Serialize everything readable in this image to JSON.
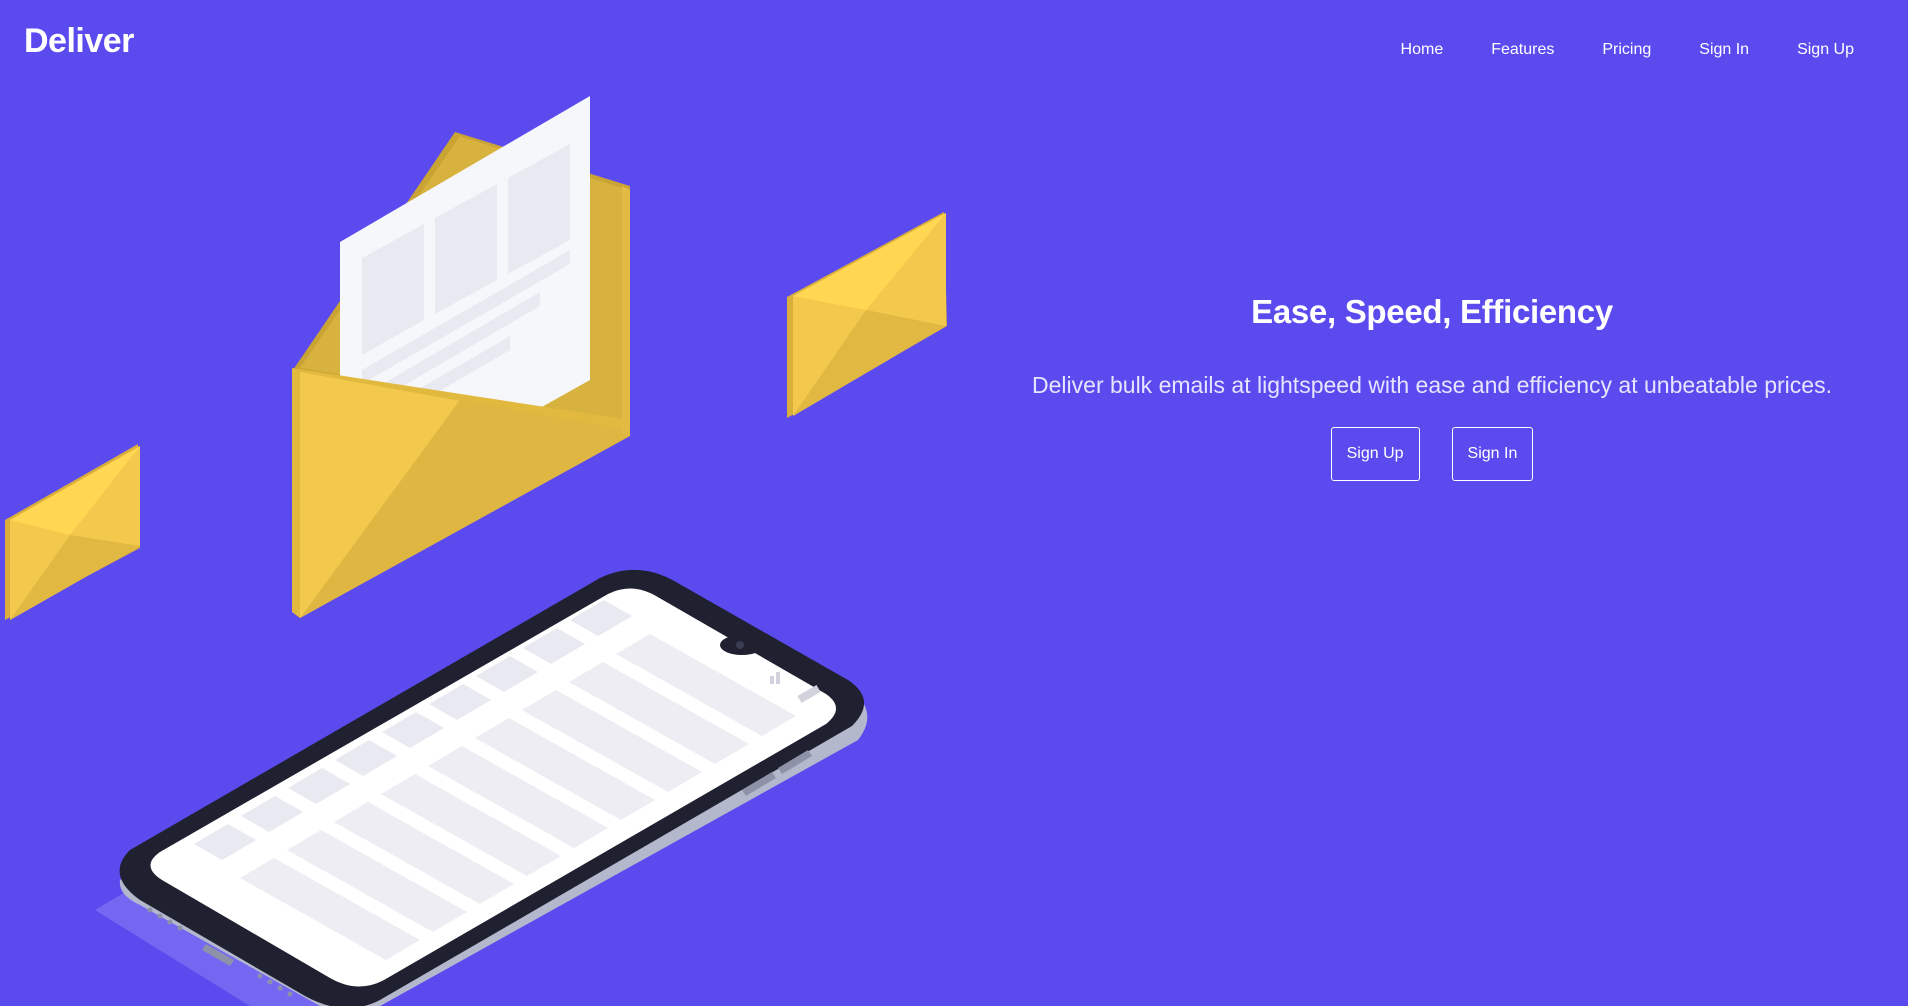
{
  "brand": {
    "name": "Deliver"
  },
  "nav": {
    "items": [
      {
        "label": "Home"
      },
      {
        "label": "Features"
      },
      {
        "label": "Pricing"
      },
      {
        "label": "Sign In"
      },
      {
        "label": "Sign Up"
      }
    ]
  },
  "hero": {
    "title": "Ease, Speed, Efficiency",
    "subtitle": "Deliver bulk emails at lightspeed with ease and efficiency at unbeatable prices.",
    "primary_button": "Sign Up",
    "secondary_button": "Sign In"
  },
  "colors": {
    "background": "#5b4bef",
    "envelope": "#f2c94c",
    "envelope_shade": "#dfb641",
    "phone_frame": "#1f2030",
    "screen": "#ffffff",
    "placeholder": "#e9e9f1"
  },
  "icons": [
    "open-envelope-icon",
    "closed-envelope-icon",
    "smartphone-icon"
  ]
}
